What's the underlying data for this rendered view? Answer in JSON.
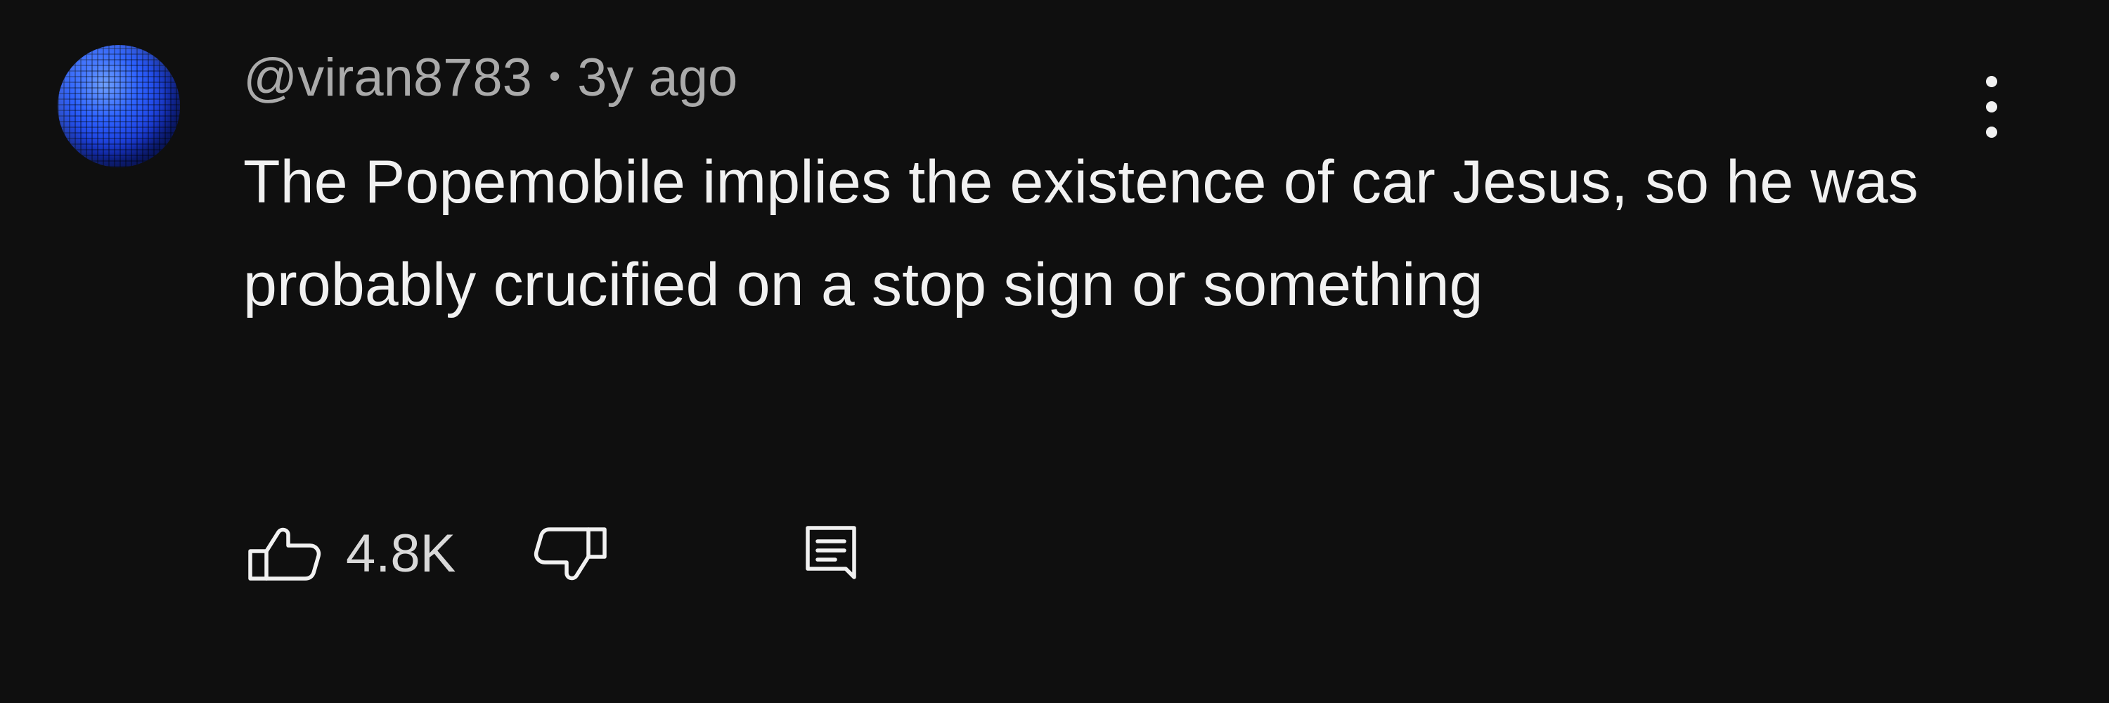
{
  "comment": {
    "username": "@viran8783",
    "separator": "•",
    "time": "3y ago",
    "text": "The Popemobile implies the existence of car Jesus, so he was probably crucified on a stop sign or something",
    "likes": "4.8K"
  },
  "icons": {
    "avatar": "blue-grid-sphere-avatar",
    "more": "more-vertical-icon",
    "like": "thumbs-up-icon",
    "dislike": "thumbs-down-icon",
    "reply": "comment-icon"
  },
  "colors": {
    "background": "#0f0f0f",
    "text": "#f1f1f1",
    "muted": "#aaaaaa",
    "avatar": "#2e63ff"
  }
}
